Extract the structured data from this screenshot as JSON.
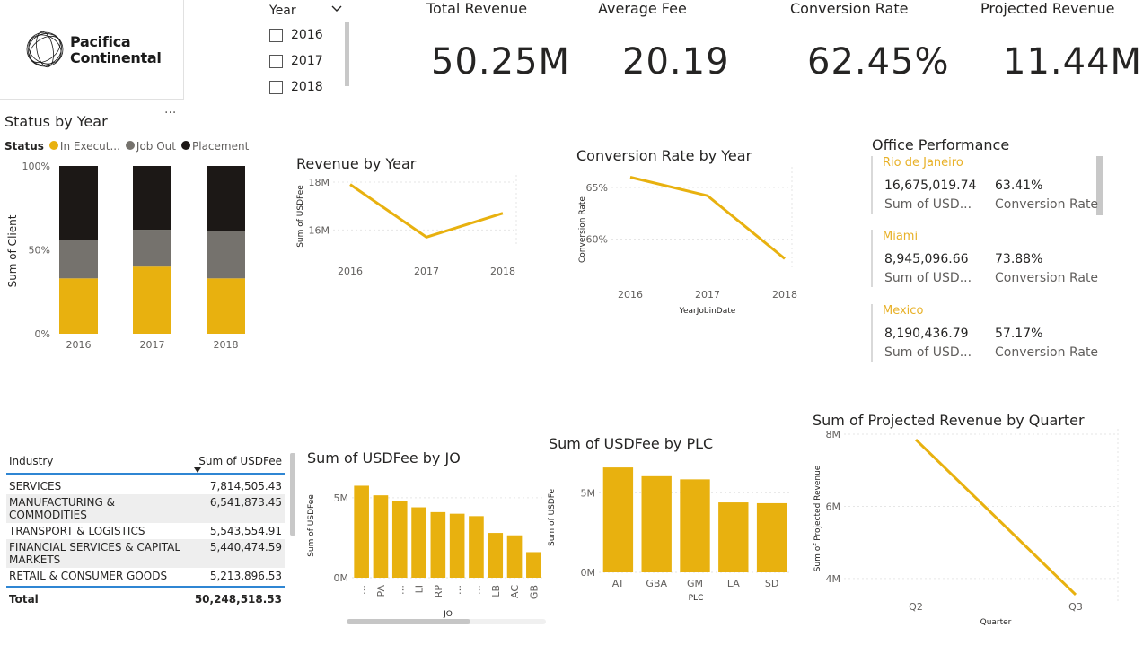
{
  "logo": {
    "line1": "Pacifica",
    "line2": "Continental"
  },
  "year_slicer": {
    "title": "Year",
    "options": [
      "2016",
      "2017",
      "2018"
    ]
  },
  "kpis": [
    {
      "title": "Total Revenue",
      "value": "50.25M"
    },
    {
      "title": "Average Fee",
      "value": "20.19"
    },
    {
      "title": "Conversion Rate",
      "value": "62.45%"
    },
    {
      "title": "Projected Revenue",
      "value": "11.44M"
    }
  ],
  "status_by_year": {
    "title": "Status by Year",
    "more_label": "...",
    "legend_title": "Status",
    "legend": [
      {
        "label": "In Execut...",
        "color": "#e8b10f"
      },
      {
        "label": "Job Out",
        "color": "#75726d"
      },
      {
        "label": "Placement",
        "color": "#1c1816"
      }
    ],
    "ylabel": "Sum of Client",
    "yticks": [
      "100%",
      "50%",
      "0%"
    ]
  },
  "office_performance": {
    "title": "Office Performance",
    "offices": [
      {
        "name": "Rio de Janeiro",
        "revenue": "16,675,019.74",
        "revenue_label": "Sum of USD...",
        "rate": "63.41%",
        "rate_label": "Conversion Rate"
      },
      {
        "name": "Miami",
        "revenue": "8,945,096.66",
        "revenue_label": "Sum of USD...",
        "rate": "73.88%",
        "rate_label": "Conversion Rate"
      },
      {
        "name": "Mexico",
        "revenue": "8,190,436.79",
        "revenue_label": "Sum of USD...",
        "rate": "57.17%",
        "rate_label": "Conversion Rate"
      }
    ]
  },
  "industry_table": {
    "col1": "Industry",
    "col2": "Sum of USDFee",
    "rows": [
      {
        "industry": "SERVICES",
        "value": "7,814,505.43"
      },
      {
        "industry": "MANUFACTURING & COMMODITIES",
        "value": "6,541,873.45"
      },
      {
        "industry": "TRANSPORT & LOGISTICS",
        "value": "5,543,554.91"
      },
      {
        "industry": "FINANCIAL SERVICES & CAPITAL MARKETS",
        "value": "5,440,474.59"
      },
      {
        "industry": "RETAIL & CONSUMER GOODS",
        "value": "5,213,896.53"
      }
    ],
    "total_label": "Total",
    "total_value": "50,248,518.53"
  },
  "colors": {
    "accent": "#e8b10f",
    "jobout": "#75726d",
    "placement": "#1c1816"
  },
  "chart_data": [
    {
      "type": "bar",
      "title": "Status by Year",
      "stacked": "100%",
      "categories": [
        "2016",
        "2017",
        "2018"
      ],
      "series": [
        {
          "name": "In Execut...",
          "values": [
            33,
            40,
            33
          ]
        },
        {
          "name": "Job Out",
          "values": [
            23,
            22,
            28
          ]
        },
        {
          "name": "Placement",
          "values": [
            44,
            38,
            39
          ]
        }
      ],
      "ylabel": "Sum of Client",
      "ylim": [
        0,
        100
      ]
    },
    {
      "type": "line",
      "title": "Revenue by Year",
      "x": [
        "2016",
        "2017",
        "2018"
      ],
      "values": [
        17.9,
        15.7,
        16.7
      ],
      "ylabel": "Sum of USDFee",
      "yticks": [
        "18M",
        "16M"
      ],
      "ylim": [
        15.3,
        18.3
      ]
    },
    {
      "type": "line",
      "title": "Conversion Rate by Year",
      "x": [
        "2016",
        "2017",
        "2018"
      ],
      "values": [
        66,
        64.2,
        58.1
      ],
      "xlabel": "YearJobinDate",
      "ylabel": "Conversion Rate",
      "yticks": [
        "65%",
        "60%"
      ],
      "ylim": [
        57,
        67
      ]
    },
    {
      "type": "bar",
      "title": "Sum of USDFee by JO",
      "categories": [
        "…",
        "PA",
        "…",
        "LI",
        "RP",
        "…",
        "…",
        "LB",
        "AC",
        "GB"
      ],
      "values": [
        5.75,
        5.15,
        4.8,
        4.4,
        4.1,
        4.0,
        3.85,
        2.8,
        2.65,
        1.6
      ],
      "xlabel": "JO",
      "ylabel": "Sum of USDFee",
      "yticks": [
        "5M",
        "0M"
      ],
      "ylim": [
        0,
        6
      ]
    },
    {
      "type": "bar",
      "title": "Sum of USDFee by PLC",
      "categories": [
        "AT",
        "GBA",
        "GM",
        "LA",
        "SD"
      ],
      "values": [
        6.6,
        6.05,
        5.85,
        4.4,
        4.35
      ],
      "xlabel": "PLC",
      "ylabel": "Sum of USDFe",
      "yticks": [
        "5M",
        "0M"
      ],
      "ylim": [
        0,
        7
      ]
    },
    {
      "type": "line",
      "title": "Sum of Projected Revenue by Quarter",
      "x": [
        "Q2",
        "Q3"
      ],
      "values": [
        7.85,
        3.55
      ],
      "xlabel": "Quarter",
      "ylabel": "Sum of Projected Revenue",
      "yticks": [
        "8M",
        "6M",
        "4M"
      ],
      "ylim": [
        3.3,
        8.15
      ]
    }
  ]
}
